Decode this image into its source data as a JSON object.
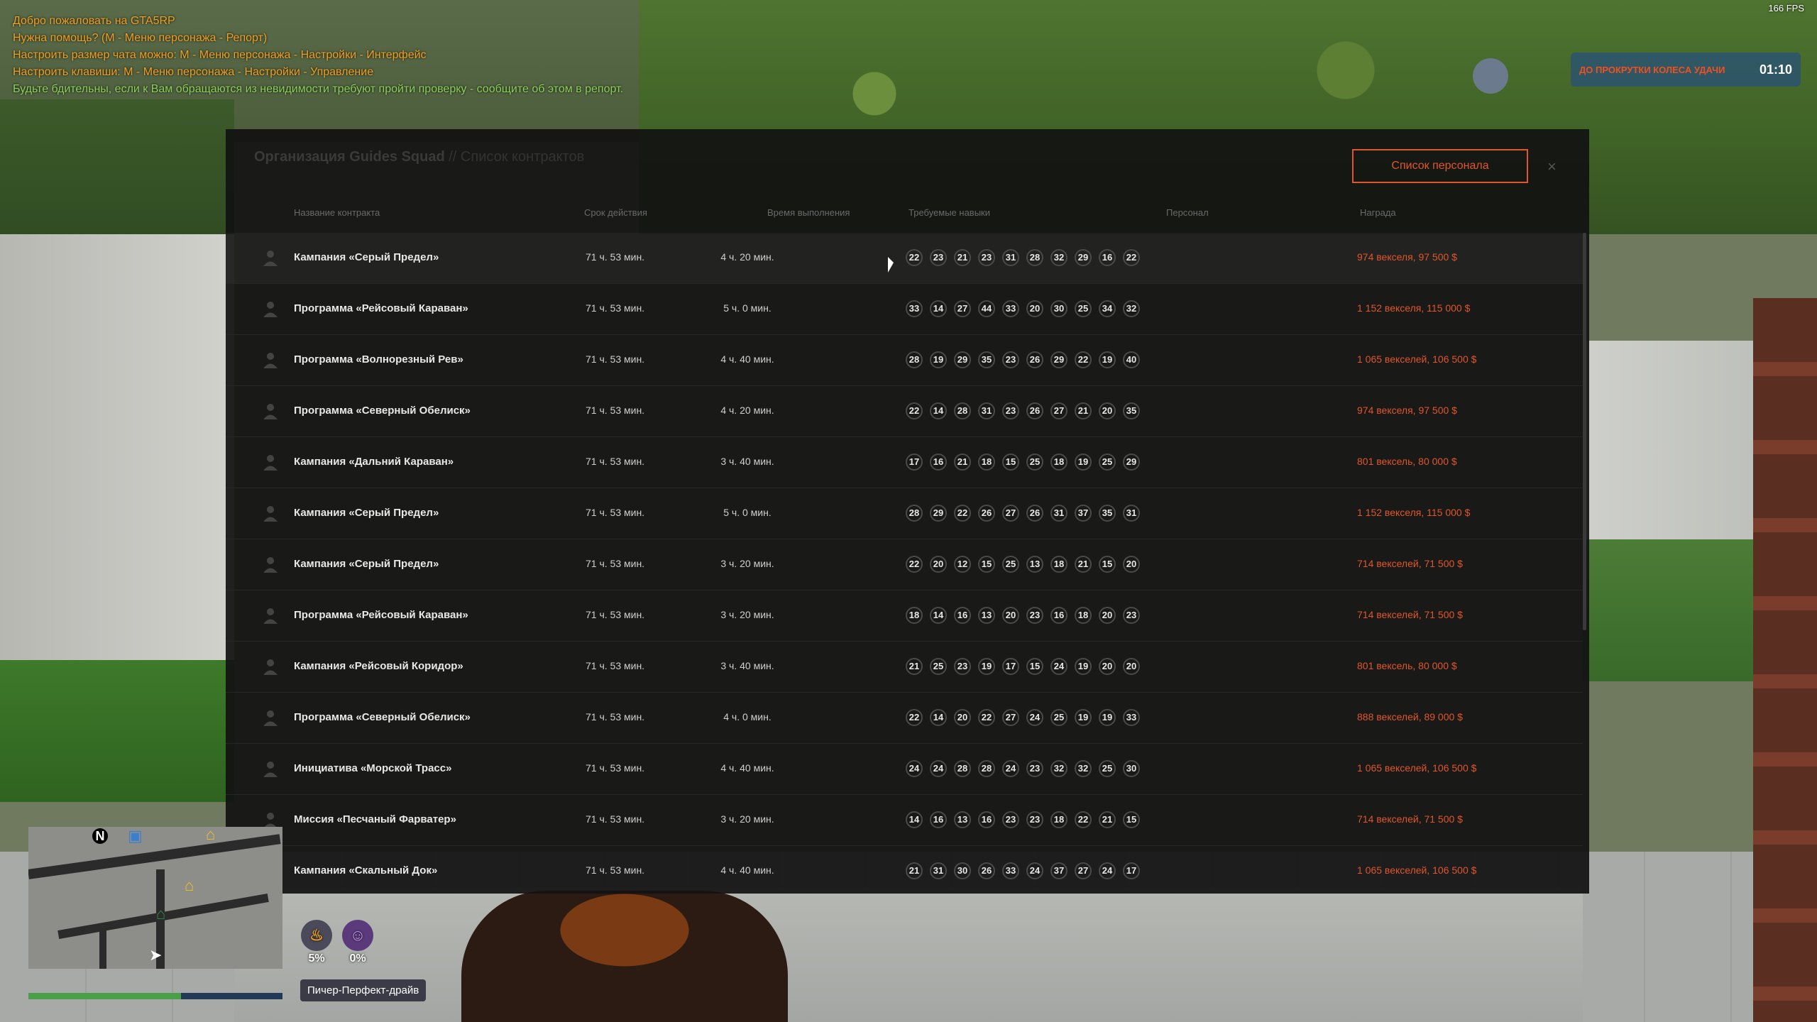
{
  "chat": [
    {
      "text": "Добро пожаловать на GTA5RP",
      "color": "orange"
    },
    {
      "text": "Нужна помощь? (M - Меню персонажа - Репорт)",
      "color": "orange"
    },
    {
      "text": "Настроить размер чата можно: M - Меню персонажа - Настройки - Интерфейс",
      "color": "orange"
    },
    {
      "text": "Настроить клавиши: M - Меню персонажа - Настройки - Управление",
      "color": "orange"
    },
    {
      "text": "Будьте бдительны, если к Вам обращаются из невидимости требуют пройти проверку - сообщите об этом в репорт.",
      "color": "green"
    }
  ],
  "fps": "166 FPS",
  "wheel": {
    "label": "ДО ПРОКРУТКИ КОЛЕСА УДАЧИ",
    "time": "01:10"
  },
  "modal": {
    "org": "Организация Guides Squad",
    "subtitle": "// Список контрактов",
    "staff_button": "Список персонала",
    "close": "×",
    "headers": {
      "name": "Название контракта",
      "expiry": "Срок действия",
      "duration": "Время выполнения",
      "skills": "Требуемые навыки",
      "staff": "Персонал",
      "reward": "Награда"
    }
  },
  "contracts": [
    {
      "name": "Кампания «Серый Предел»",
      "expiry": "71 ч. 53 мин.",
      "duration": "4 ч. 20 мин.",
      "skills": [
        "22",
        "23",
        "21",
        "23",
        "31",
        "28",
        "32",
        "29",
        "16",
        "22"
      ],
      "reward": "974 векселя, 97 500 $"
    },
    {
      "name": "Программа «Рейсовый Караван»",
      "expiry": "71 ч. 53 мин.",
      "duration": "5 ч. 0 мин.",
      "skills": [
        "33",
        "14",
        "27",
        "44",
        "33",
        "20",
        "30",
        "25",
        "34",
        "32"
      ],
      "reward": "1 152 векселя, 115 000 $"
    },
    {
      "name": "Программа «Волнорезный Рев»",
      "expiry": "71 ч. 53 мин.",
      "duration": "4 ч. 40 мин.",
      "skills": [
        "28",
        "19",
        "29",
        "35",
        "23",
        "26",
        "29",
        "22",
        "19",
        "40"
      ],
      "reward": "1 065 векселей, 106 500 $"
    },
    {
      "name": "Программа «Северный Обелиск»",
      "expiry": "71 ч. 53 мин.",
      "duration": "4 ч. 20 мин.",
      "skills": [
        "22",
        "14",
        "28",
        "31",
        "23",
        "26",
        "27",
        "21",
        "20",
        "35"
      ],
      "reward": "974 векселя, 97 500 $"
    },
    {
      "name": "Кампания «Дальний Караван»",
      "expiry": "71 ч. 53 мин.",
      "duration": "3 ч. 40 мин.",
      "skills": [
        "17",
        "16",
        "21",
        "18",
        "15",
        "25",
        "18",
        "19",
        "25",
        "29"
      ],
      "reward": "801 вексель, 80 000 $"
    },
    {
      "name": "Кампания «Серый Предел»",
      "expiry": "71 ч. 53 мин.",
      "duration": "5 ч. 0 мин.",
      "skills": [
        "28",
        "29",
        "22",
        "26",
        "27",
        "26",
        "31",
        "37",
        "35",
        "31"
      ],
      "reward": "1 152 векселя, 115 000 $"
    },
    {
      "name": "Кампания «Серый Предел»",
      "expiry": "71 ч. 53 мин.",
      "duration": "3 ч. 20 мин.",
      "skills": [
        "22",
        "20",
        "12",
        "15",
        "25",
        "13",
        "18",
        "21",
        "15",
        "20"
      ],
      "reward": "714 векселей, 71 500 $"
    },
    {
      "name": "Программа «Рейсовый Караван»",
      "expiry": "71 ч. 53 мин.",
      "duration": "3 ч. 20 мин.",
      "skills": [
        "18",
        "14",
        "16",
        "13",
        "20",
        "23",
        "16",
        "18",
        "20",
        "23"
      ],
      "reward": "714 векселей, 71 500 $"
    },
    {
      "name": "Кампания «Рейсовый Коридор»",
      "expiry": "71 ч. 53 мин.",
      "duration": "3 ч. 40 мин.",
      "skills": [
        "21",
        "25",
        "23",
        "19",
        "17",
        "15",
        "24",
        "19",
        "20",
        "20"
      ],
      "reward": "801 вексель, 80 000 $"
    },
    {
      "name": "Программа «Северный Обелиск»",
      "expiry": "71 ч. 53 мин.",
      "duration": "4 ч. 0 мин.",
      "skills": [
        "22",
        "14",
        "20",
        "22",
        "27",
        "24",
        "25",
        "19",
        "19",
        "33"
      ],
      "reward": "888 векселей, 89 000 $"
    },
    {
      "name": "Инициатива «Морской Трасс»",
      "expiry": "71 ч. 53 мин.",
      "duration": "4 ч. 40 мин.",
      "skills": [
        "24",
        "24",
        "28",
        "28",
        "24",
        "23",
        "32",
        "32",
        "25",
        "30"
      ],
      "reward": "1 065 векселей, 106 500 $"
    },
    {
      "name": "Миссия «Песчаный Фарватер»",
      "expiry": "71 ч. 53 мин.",
      "duration": "3 ч. 20 мин.",
      "skills": [
        "14",
        "16",
        "13",
        "16",
        "23",
        "23",
        "18",
        "22",
        "21",
        "15"
      ],
      "reward": "714 векселей, 71 500 $"
    },
    {
      "name": "Кампания «Скальный Док»",
      "expiry": "71 ч. 53 мин.",
      "duration": "4 ч. 40 мин.",
      "skills": [
        "21",
        "31",
        "30",
        "26",
        "33",
        "24",
        "37",
        "27",
        "24",
        "17"
      ],
      "reward": "1 065 векселей, 106 500 $"
    }
  ],
  "hud": {
    "hunger": "5%",
    "thirst": "0%",
    "vehicle": "Пичер-Перфект-драйв",
    "health_fraction": 0.6,
    "north": "N"
  }
}
